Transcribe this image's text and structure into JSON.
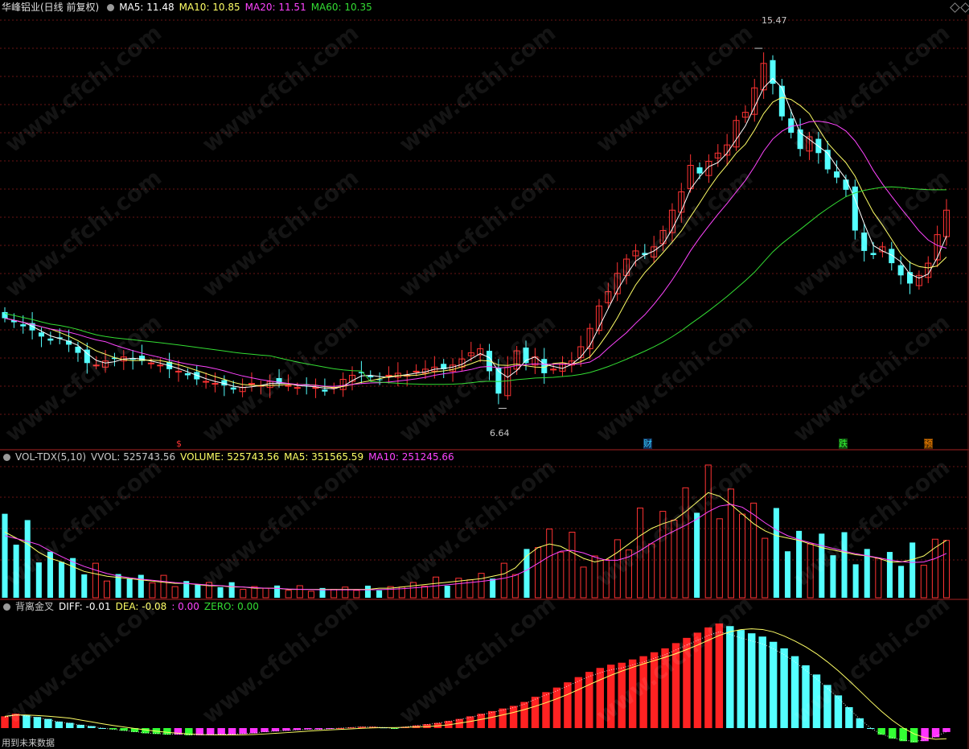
{
  "main": {
    "stock": "华峰铝业(日线 前复权)",
    "ma_labels": [
      {
        "text": "MA5: 11.48",
        "color": "#ffffff"
      },
      {
        "text": "MA10: 10.85",
        "color": "#ffff66"
      },
      {
        "text": "MA20: 11.51",
        "color": "#ff44ff"
      },
      {
        "text": "MA60: 10.35",
        "color": "#33dd33"
      }
    ],
    "high_label": "15.47",
    "low_label": "6.64",
    "markers": [
      {
        "text": "$",
        "color": "#ff3333"
      },
      {
        "text": "财",
        "color": "#33ccff"
      },
      {
        "text": "跌",
        "color": "#33ff33"
      },
      {
        "text": "预",
        "color": "#ff8800"
      }
    ]
  },
  "volume": {
    "indicator": "VOL-TDX(5,10)",
    "labels": [
      {
        "text": "VVOL: 525743.56",
        "color": "#c8c8c8"
      },
      {
        "text": "VOLUME: 525743.56",
        "color": "#ffff66"
      },
      {
        "text": "MA5: 351565.59",
        "color": "#ffff66"
      },
      {
        "text": "MA10: 251245.66",
        "color": "#ff44ff"
      }
    ]
  },
  "macd": {
    "indicator": "背离金叉",
    "labels": [
      {
        "text": "DIFF: -0.01",
        "color": "#ffffff"
      },
      {
        "text": "DEA: -0.08",
        "color": "#ffff66"
      },
      {
        "text": ": 0.00",
        "color": "#ff44ff"
      },
      {
        "text": "ZERO: 0.00",
        "color": "#33dd33"
      }
    ]
  },
  "footer": "用到未来数据",
  "watermark": "www.cfchi.com",
  "chart_data": {
    "type": "candlestick",
    "price_range": [
      5.9,
      16.3
    ],
    "highlighted": {
      "high": 15.47,
      "low": 6.64
    },
    "colors": {
      "up": "#ff3333",
      "down": "#54ffff",
      "ma5": "#ffffff",
      "ma10": "#ffff66",
      "ma20": "#ff44ff",
      "ma60": "#33dd33",
      "vol_ma": "#ffff66",
      "vol_ma10": "#ff44ff",
      "macd_up": "#ff2222",
      "macd_down": "#54ffff",
      "macd_neg_up": "#33ff33",
      "macd_neg_down": "#ff33ff"
    },
    "closes": [
      8.85,
      8.75,
      8.65,
      8.55,
      8.4,
      8.3,
      8.35,
      8.2,
      8.0,
      7.75,
      7.7,
      7.8,
      7.85,
      7.9,
      7.85,
      7.8,
      7.75,
      7.7,
      7.6,
      7.55,
      7.45,
      7.35,
      7.3,
      7.25,
      7.2,
      7.1,
      7.15,
      7.25,
      7.2,
      7.3,
      7.25,
      7.2,
      7.15,
      7.2,
      7.15,
      7.05,
      7.15,
      7.35,
      7.45,
      7.5,
      7.4,
      7.35,
      7.45,
      7.5,
      7.45,
      7.55,
      7.6,
      7.65,
      7.6,
      7.7,
      7.85,
      8.0,
      8.1,
      7.55,
      7.0,
      7.65,
      8.05,
      7.75,
      7.9,
      7.5,
      7.6,
      7.75,
      7.8,
      8.15,
      8.6,
      9.15,
      9.5,
      9.95,
      10.3,
      10.5,
      10.4,
      10.6,
      11.0,
      11.5,
      11.95,
      12.6,
      12.4,
      12.7,
      12.9,
      13.1,
      13.7,
      13.9,
      14.5,
      15.1,
      14.6,
      13.8,
      13.4,
      13.0,
      13.3,
      12.9,
      12.5,
      12.3,
      12.0,
      11.0,
      10.5,
      10.4,
      10.6,
      10.2,
      9.9,
      9.7,
      9.9,
      10.2,
      10.9,
      11.5
    ],
    "volume_ma5": [
      0.55,
      0.5,
      0.45,
      0.38,
      0.33,
      0.3,
      0.26,
      0.22,
      0.2,
      0.18,
      0.17,
      0.16,
      0.15,
      0.14,
      0.13,
      0.12,
      0.12,
      0.11,
      0.1,
      0.1,
      0.09,
      0.09,
      0.08,
      0.08,
      0.08,
      0.07,
      0.07,
      0.07,
      0.07,
      0.07,
      0.07,
      0.07,
      0.07,
      0.08,
      0.08,
      0.09,
      0.1,
      0.11,
      0.12,
      0.13,
      0.14,
      0.15,
      0.16,
      0.18,
      0.2,
      0.25,
      0.35,
      0.42,
      0.45,
      0.43,
      0.38,
      0.33,
      0.3,
      0.32,
      0.38,
      0.45,
      0.52,
      0.58,
      0.62,
      0.65,
      0.72,
      0.8,
      0.88,
      0.85,
      0.78,
      0.7,
      0.62,
      0.56,
      0.52,
      0.5,
      0.48,
      0.45,
      0.42,
      0.4,
      0.38,
      0.36,
      0.35,
      0.33,
      0.3,
      0.3,
      0.32,
      0.35,
      0.42,
      0.48
    ],
    "macd_hist": [
      0.18,
      0.22,
      0.2,
      0.17,
      0.14,
      0.1,
      0.08,
      0.05,
      0.03,
      0.0,
      -0.02,
      -0.04,
      -0.06,
      -0.08,
      -0.09,
      -0.1,
      -0.1,
      -0.11,
      -0.11,
      -0.11,
      -0.1,
      -0.1,
      -0.09,
      -0.08,
      -0.06,
      -0.05,
      -0.04,
      -0.03,
      -0.02,
      -0.02,
      -0.01,
      0.0,
      0.01,
      0.02,
      0.02,
      0.01,
      -0.01,
      0.02,
      0.04,
      0.06,
      0.08,
      0.11,
      0.14,
      0.18,
      0.22,
      0.26,
      0.3,
      0.34,
      0.4,
      0.48,
      0.55,
      0.62,
      0.7,
      0.78,
      0.86,
      0.92,
      0.97,
      1.0,
      1.05,
      1.1,
      1.16,
      1.22,
      1.3,
      1.38,
      1.46,
      1.54,
      1.6,
      1.56,
      1.5,
      1.45,
      1.4,
      1.32,
      1.22,
      1.1,
      0.96,
      0.82,
      0.66,
      0.5,
      0.32,
      0.15,
      0.0,
      -0.1,
      -0.16,
      -0.2,
      -0.22,
      -0.2,
      -0.14,
      -0.06
    ]
  }
}
